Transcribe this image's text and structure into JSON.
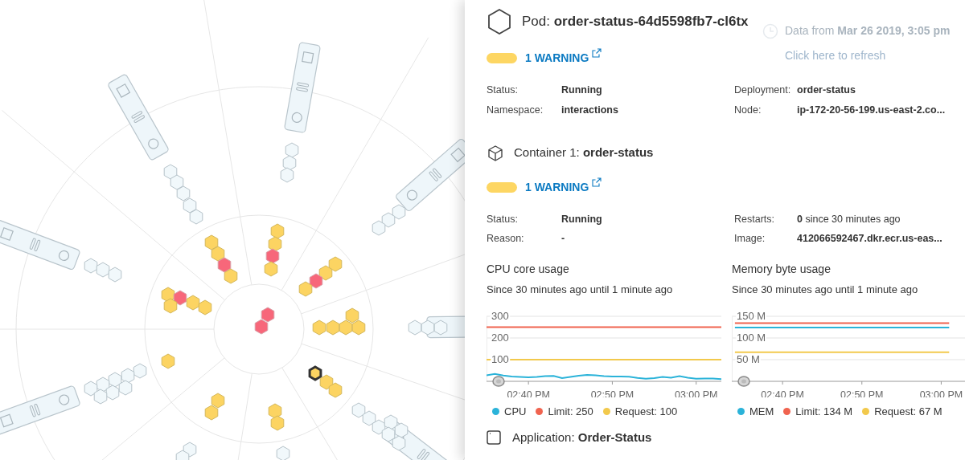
{
  "pod": {
    "title": "Pod: **order-status-64d5598fb7-cl6tx**",
    "warning": "1 WARNING",
    "fields": [
      {
        "label": "Status:",
        "value": "Running"
      },
      {
        "label": "Deployment:",
        "value": "order-status"
      },
      {
        "label": "Namespace:",
        "value": "interactions"
      },
      {
        "label": "Node:",
        "value": "ip-172-20-56-199.us-east-2.co..."
      }
    ]
  },
  "data_freshness": {
    "text": "Data from **Mar 26 2019, 3:05 pm**",
    "refresh_link": "Click here to refresh"
  },
  "container": {
    "title": "Container 1: **order-status**",
    "warning": "1 WARNING",
    "fields": [
      {
        "label": "Status:",
        "value": "**Running**"
      },
      {
        "label": "Restarts:",
        "value": "**0** since 30 minutes ago"
      },
      {
        "label": "Reason:",
        "value": "**-**"
      },
      {
        "label": "Image:",
        "value": "**412066592467.dkr.ecr.us-eas...**"
      }
    ]
  },
  "charts": [
    {
      "title": "CPU core usage",
      "subtitle": "Since 30 minutes ago until 1 minute ago",
      "chart_data": {
        "type": "line",
        "categories": [
          null,
          null,
          null,
          null,
          null,
          "02:40 PM",
          null,
          null,
          null,
          null,
          null,
          null,
          null,
          null,
          null,
          "02:50 PM",
          null,
          null,
          null,
          null,
          null,
          null,
          null,
          null,
          null,
          "03:00 PM",
          null,
          null,
          null
        ],
        "grid": true,
        "ylim": [
          0,
          300
        ],
        "yticks": [
          100,
          200,
          300
        ],
        "series": [
          {
            "name": "CPU",
            "color": "#2bb3d9",
            "values": [
              28,
              34,
              27,
              22,
              20,
              19,
              20,
              24,
              25,
              15,
              20,
              26,
              30,
              28,
              24,
              22,
              22,
              21,
              16,
              12,
              15,
              20,
              17,
              24,
              17,
              12,
              13,
              13,
              10
            ]
          },
          {
            "name": "Limit: 250",
            "color": "#f0634f",
            "values": [
              250,
              250,
              250,
              250,
              250,
              250,
              250,
              250,
              250,
              250,
              250,
              250,
              250,
              250,
              250,
              250,
              250,
              250,
              250,
              250,
              250,
              250,
              250,
              250,
              250,
              250,
              250,
              250,
              250
            ]
          },
          {
            "name": "Request: 100",
            "color": "#f2c94c",
            "values": [
              100,
              100,
              100,
              100,
              100,
              100,
              100,
              100,
              100,
              100,
              100,
              100,
              100,
              100,
              100,
              100,
              100,
              100,
              100,
              100,
              100,
              100,
              100,
              100,
              100,
              100,
              100,
              100,
              100
            ]
          }
        ]
      }
    },
    {
      "title": "Memory byte usage",
      "subtitle": "Since 30 minutes ago until 1 minute ago",
      "chart_data": {
        "type": "line",
        "categories": [
          null,
          null,
          null,
          null,
          null,
          null,
          "02:40 PM",
          null,
          null,
          null,
          null,
          null,
          null,
          null,
          null,
          null,
          "02:50 PM",
          null,
          null,
          null,
          null,
          null,
          null,
          null,
          null,
          null,
          "03:00 PM",
          null
        ],
        "grid": true,
        "ylim": [
          0,
          150
        ],
        "yticks": [
          {
            "value": 50,
            "label": "50 M"
          },
          {
            "value": 100,
            "label": "100 M"
          },
          {
            "value": 150,
            "label": "150 M"
          }
        ],
        "series": [
          {
            "name": "MEM",
            "color": "#2bb3d9",
            "values": [
              124,
              124,
              124,
              124,
              124,
              124,
              124,
              124,
              124,
              124,
              124,
              124,
              124,
              124,
              124,
              124,
              124,
              124,
              124,
              124,
              124,
              124,
              124,
              124,
              124,
              124,
              124,
              124
            ]
          },
          {
            "name": "Limit: 134 M",
            "color": "#f0634f",
            "values": [
              134,
              134,
              134,
              134,
              134,
              134,
              134,
              134,
              134,
              134,
              134,
              134,
              134,
              134,
              134,
              134,
              134,
              134,
              134,
              134,
              134,
              134,
              134,
              134,
              134,
              134,
              134,
              134
            ]
          },
          {
            "name": "Request: 67 M",
            "color": "#f2c94c",
            "values": [
              67,
              67,
              67,
              67,
              67,
              67,
              67,
              67,
              67,
              67,
              67,
              67,
              67,
              67,
              67,
              67,
              67,
              67,
              67,
              67,
              67,
              67,
              67,
              67,
              67,
              67,
              67,
              67
            ]
          }
        ]
      }
    }
  ],
  "application": {
    "title": "Application: **Order-Status**"
  }
}
